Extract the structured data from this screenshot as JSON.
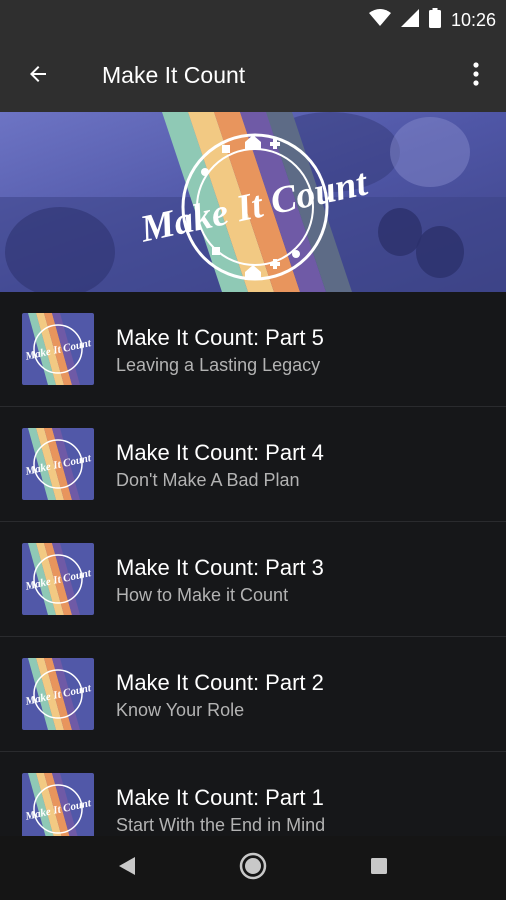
{
  "status_bar": {
    "time": "10:26",
    "icons": [
      "wifi-icon",
      "cellular-signal-icon",
      "battery-icon"
    ]
  },
  "app_bar": {
    "title": "Make It Count",
    "back_icon": "arrow-back-icon",
    "menu_icon": "more-vert-icon"
  },
  "banner": {
    "logo_text": "Make It Count",
    "stripe_colors": [
      "#8fc9b5",
      "#f2c983",
      "#e8955d",
      "#6f5aa6",
      "#5d6b86"
    ]
  },
  "episodes": [
    {
      "title": "Make It Count: Part 5",
      "subtitle": "Leaving a Lasting Legacy"
    },
    {
      "title": "Make It Count: Part 4",
      "subtitle": "Don't Make A Bad Plan"
    },
    {
      "title": "Make It Count: Part 3",
      "subtitle": "How to Make it Count"
    },
    {
      "title": "Make It Count: Part 2",
      "subtitle": "Know Your Role"
    },
    {
      "title": "Make It Count: Part 1",
      "subtitle": "Start With the End in Mind"
    }
  ],
  "nav_bar": {
    "icons": [
      "nav-back-icon",
      "nav-home-icon",
      "nav-recents-icon"
    ]
  },
  "colors": {
    "bar_background": "#2f2f2f",
    "list_background": "#161719",
    "brand_blue": "#5158a8"
  }
}
